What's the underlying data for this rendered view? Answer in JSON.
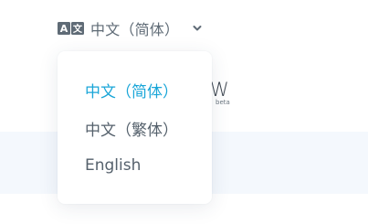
{
  "language_switcher": {
    "icon": "translate-icon",
    "current_label": "中文（简体）",
    "chevron_icon": "chevron-down-icon"
  },
  "dropdown": {
    "options": [
      {
        "label": "中文（简体）",
        "selected": true
      },
      {
        "label": "中文（繁体）",
        "selected": false
      },
      {
        "label": "English",
        "selected": false
      }
    ]
  },
  "logo": {
    "visible_fragment": "W",
    "badge": "beta"
  },
  "colors": {
    "accent": "#1aa6d8",
    "text": "#55616c",
    "icon": "#5f6b76"
  }
}
